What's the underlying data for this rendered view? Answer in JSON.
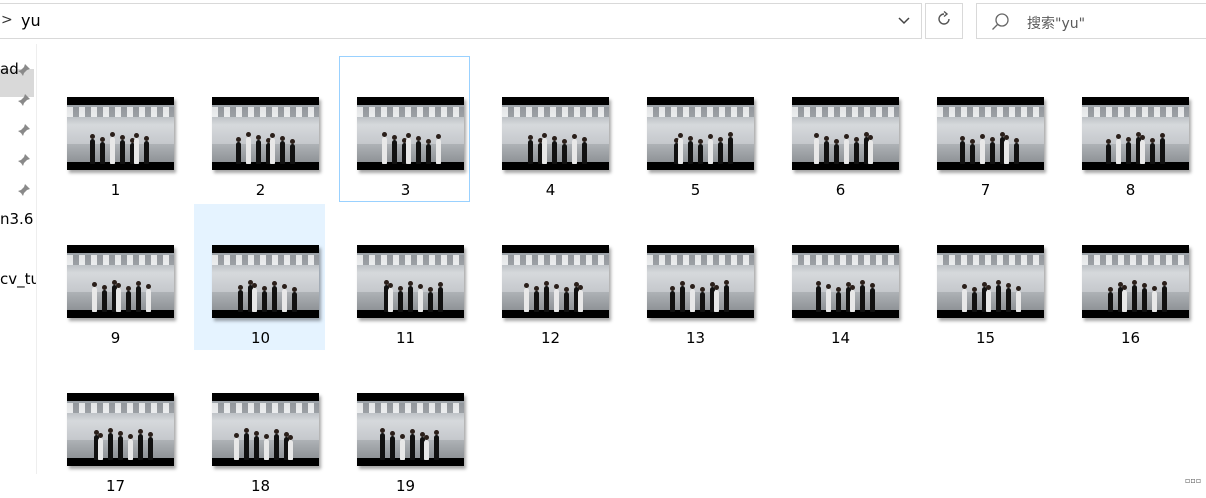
{
  "address_bar": {
    "separator": ">",
    "path": "yu"
  },
  "search": {
    "placeholder": "搜索\"yu\""
  },
  "nav": {
    "items": [
      {
        "label": "ad",
        "pinned": true
      },
      {
        "label": "",
        "pinned": true
      },
      {
        "label": "",
        "pinned": true
      },
      {
        "label": "",
        "pinned": true
      },
      {
        "label": "",
        "pinned": true
      },
      {
        "label": "n3.6",
        "pinned": false
      },
      {
        "label": "cv_tu",
        "pinned": false
      }
    ]
  },
  "files": [
    {
      "name": "1"
    },
    {
      "name": "2"
    },
    {
      "name": "3",
      "focused": true
    },
    {
      "name": "4"
    },
    {
      "name": "5"
    },
    {
      "name": "6"
    },
    {
      "name": "7"
    },
    {
      "name": "8"
    },
    {
      "name": "9"
    },
    {
      "name": "10",
      "selected": true
    },
    {
      "name": "11"
    },
    {
      "name": "12"
    },
    {
      "name": "13"
    },
    {
      "name": "14"
    },
    {
      "name": "15"
    },
    {
      "name": "16"
    },
    {
      "name": "17"
    },
    {
      "name": "18"
    },
    {
      "name": "19"
    }
  ],
  "colors": {
    "selection_bg": "#e5f3ff",
    "focus_border": "#99d1ff"
  }
}
